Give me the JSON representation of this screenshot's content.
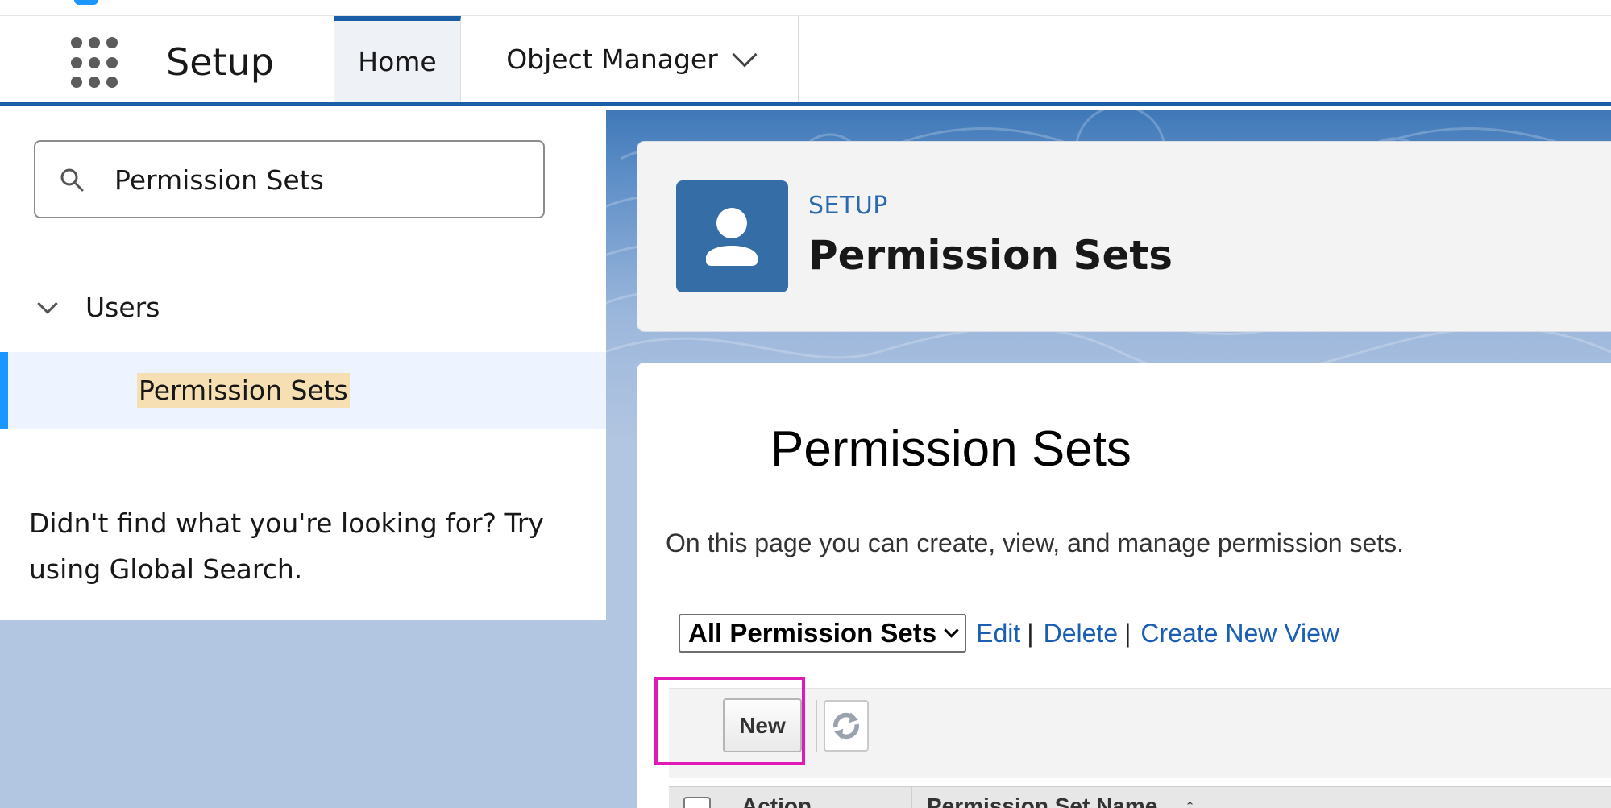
{
  "nav": {
    "app_name": "Setup",
    "tabs": [
      {
        "label": "Home",
        "active": true
      },
      {
        "label": "Object Manager",
        "has_dropdown": true
      }
    ]
  },
  "sidebar": {
    "search": {
      "value": "Permission Sets"
    },
    "tree": {
      "group_label": "Users",
      "active_item": "Permission Sets"
    },
    "not_found_text": "Didn't find what you're looking for? Try using Global Search."
  },
  "header": {
    "eyebrow": "SETUP",
    "title": "Permission Sets",
    "icon": "user-icon"
  },
  "content": {
    "title": "Permission Sets",
    "description": "On this page you can create, view, and manage permission sets.",
    "view_select": "All Permission Sets",
    "view_links": {
      "edit": "Edit",
      "delete": "Delete",
      "create": "Create New View"
    },
    "separator": "|",
    "buttons": {
      "new": "New",
      "refresh_icon": "refresh-icon"
    },
    "table_headers": {
      "action": "Action",
      "name": "Permission Set Name",
      "sort_indicator": "↑"
    }
  },
  "colors": {
    "brand_blue": "#1b5ea8",
    "link_blue": "#1a5fb4",
    "highlight_magenta": "#e01ab4",
    "active_item_bg": "#eef4ff",
    "search_highlight": "#f6dfb2"
  }
}
